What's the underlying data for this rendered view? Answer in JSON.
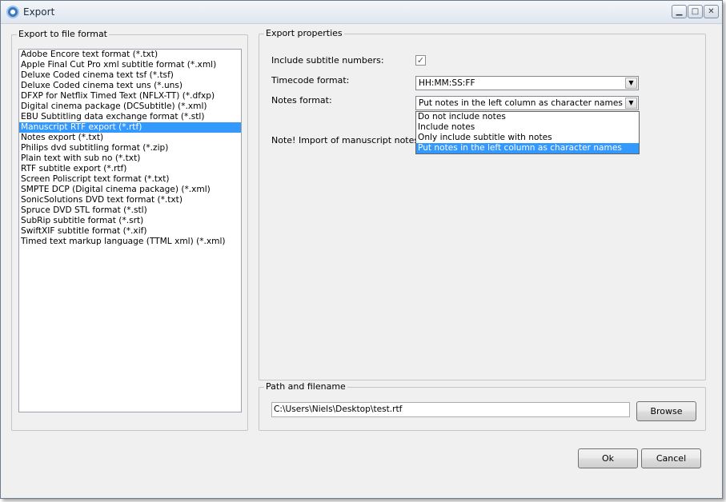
{
  "window": {
    "title": "Export",
    "minimize_icon": "minimize-icon",
    "maximize_icon": "maximize-icon",
    "close_icon": "close-icon",
    "minimize_glyph": "▁",
    "maximize_glyph": "□",
    "close_glyph": "✕"
  },
  "left_panel": {
    "title": "Export to file format",
    "formats": [
      "Adobe Encore text format (*.txt)",
      "Apple Final Cut Pro xml subtitle format (*.xml)",
      "Deluxe Coded cinema text tsf (*.tsf)",
      "Deluxe Coded cinema text uns (*.uns)",
      "DFXP for Netflix Timed Text (NFLX-TT) (*.dfxp)",
      "Digital cinema package (DCSubtitle) (*.xml)",
      "EBU Subtitling data exchange format (*.stl)",
      "Manuscript RTF export (*.rtf)",
      "Notes export (*.txt)",
      "Philips dvd subtitling format (*.zip)",
      "Plain text with sub no (*.txt)",
      "RTF subtitle export (*.rtf)",
      "Screen Poliscript text format (*.txt)",
      "SMPTE DCP (Digital cinema package) (*.xml)",
      "SonicSolutions DVD text format (*.txt)",
      "Spruce DVD STL format (*.stl)",
      "SubRip subtitle format (*.srt)",
      "SwiftXIF subtitle format (*.xif)",
      "Timed text markup language (TTML xml) (*.xml)"
    ],
    "selected_index": 7
  },
  "properties": {
    "title": "Export properties",
    "include_numbers_label": "Include subtitle numbers:",
    "include_numbers_checked": true,
    "check_glyph": "✓",
    "timecode_label": "Timecode format:",
    "timecode_value": "HH:MM:SS:FF",
    "notes_label": "Notes format:",
    "notes_value": "Put notes in the left column as character names",
    "notes_options": [
      "Do not include notes",
      "Include notes",
      "Only include subtitle with notes",
      "Put notes in the left column as character names"
    ],
    "notes_selected_index": 3,
    "note_text": "Note! Import of manuscript notes d",
    "arrow_glyph": "▼"
  },
  "path": {
    "title": "Path and filename",
    "value": "C:\\Users\\Niels\\Desktop\\test.rtf",
    "browse_label": "Browse"
  },
  "actions": {
    "ok_label": "Ok",
    "cancel_label": "Cancel"
  }
}
